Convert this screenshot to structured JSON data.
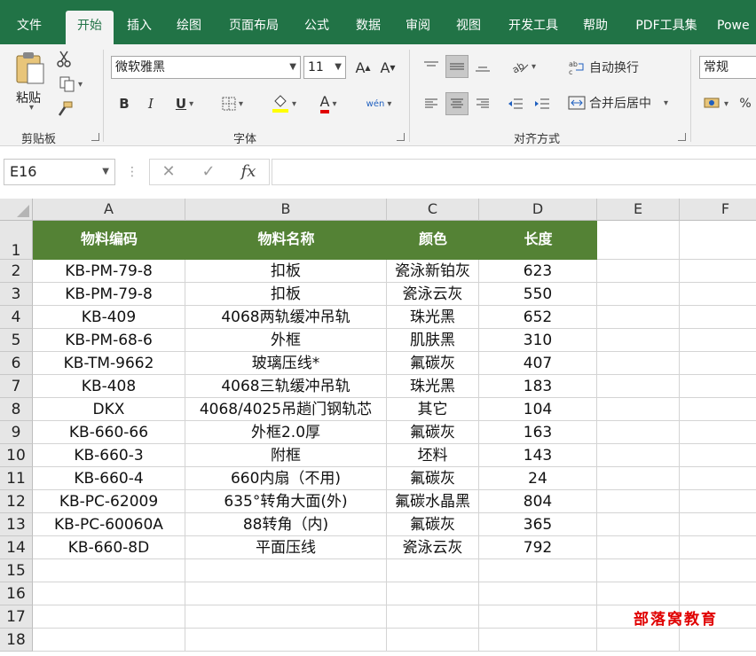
{
  "tabs": [
    "文件",
    "开始",
    "插入",
    "绘图",
    "页面布局",
    "公式",
    "数据",
    "审阅",
    "视图",
    "开发工具",
    "帮助",
    "PDF工具集",
    "Powe"
  ],
  "active_tab": "开始",
  "ribbon": {
    "clipboard": {
      "paste_label": "粘贴",
      "group_label": "剪贴板"
    },
    "font": {
      "font_name": "微软雅黑",
      "font_size": "11",
      "bold": "B",
      "italic": "I",
      "underline": "U",
      "font_color_glyph": "A",
      "phonetic_glyph": "wén",
      "group_label": "字体"
    },
    "alignment": {
      "wrap_text": "自动换行",
      "merge_center": "合并后居中",
      "group_label": "对齐方式"
    },
    "number": {
      "format": "常规",
      "percent": "%"
    }
  },
  "formula_bar": {
    "name_box": "E16",
    "cancel": "✕",
    "enter": "✓",
    "fx": "fx",
    "formula": ""
  },
  "sheet": {
    "columns": [
      "A",
      "B",
      "C",
      "D",
      "E",
      "F"
    ],
    "rows": [
      "1",
      "2",
      "3",
      "4",
      "5",
      "6",
      "7",
      "8",
      "9",
      "10",
      "11",
      "12",
      "13",
      "14",
      "15",
      "16",
      "17",
      "18"
    ],
    "headers": [
      "物料编码",
      "物料名称",
      "颜色",
      "长度"
    ],
    "data": [
      [
        "KB-PM-79-8",
        "扣板",
        "瓷泳新铂灰",
        "623"
      ],
      [
        "KB-PM-79-8",
        "扣板",
        "瓷泳云灰",
        "550"
      ],
      [
        "KB-409",
        "4068两轨缓冲吊轨",
        "珠光黑",
        "652"
      ],
      [
        "KB-PM-68-6",
        "外框",
        "肌肤黑",
        "310"
      ],
      [
        "KB-TM-9662",
        "玻璃压线*",
        "氟碳灰",
        "407"
      ],
      [
        "KB-408",
        "4068三轨缓冲吊轨",
        "珠光黑",
        "183"
      ],
      [
        "DKX",
        "4068/4025吊趟门钢轨芯",
        "其它",
        "104"
      ],
      [
        "KB-660-66",
        "外框2.0厚",
        "氟碳灰",
        "163"
      ],
      [
        "KB-660-3",
        "附框",
        "坯料",
        "143"
      ],
      [
        "KB-660-4",
        "660内扇（不用)",
        "氟碳灰",
        "24"
      ],
      [
        "KB-PC-62009",
        "635°转角大面(外)",
        "氟碳水晶黑",
        "804"
      ],
      [
        "KB-PC-60060A",
        "88转角（内)",
        "氟碳灰",
        "365"
      ],
      [
        "KB-660-8D",
        "平面压线",
        "瓷泳云灰",
        "792"
      ]
    ],
    "header_color": "#548235",
    "watermark": "部落窝教育"
  }
}
